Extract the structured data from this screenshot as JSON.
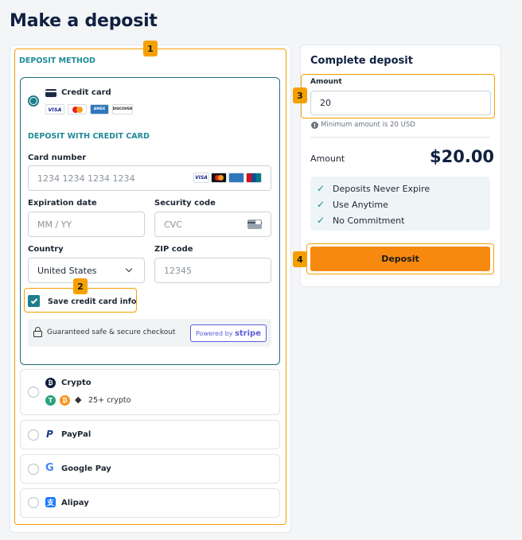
{
  "page_title": "Make a deposit",
  "callouts": [
    "1",
    "2",
    "3",
    "4"
  ],
  "deposit_method": {
    "heading": "DEPOSIT METHOD",
    "credit_card": {
      "name": "Credit card",
      "logos": [
        "VISA",
        "",
        "AMEX",
        "DISCOVER"
      ],
      "section_heading": "DEPOSIT WITH CREDIT CARD",
      "card_number": {
        "label": "Card number",
        "placeholder": "1234 1234 1234 1234"
      },
      "expiration": {
        "label": "Expiration date",
        "placeholder": "MM / YY"
      },
      "security": {
        "label": "Security code",
        "placeholder": "CVC"
      },
      "country": {
        "label": "Country",
        "value": "United States"
      },
      "zip": {
        "label": "ZIP code",
        "placeholder": "12345"
      },
      "save_card": {
        "label": "Save credit card info",
        "checked": true
      },
      "secure_text": "Guaranteed safe & secure checkout",
      "powered_by": "Powered by",
      "stripe": "stripe"
    },
    "crypto": {
      "name": "Crypto",
      "more": "25+ crypto"
    },
    "paypal": {
      "name": "PayPal"
    },
    "google_pay": {
      "name": "Google Pay"
    },
    "alipay": {
      "name": "Alipay"
    }
  },
  "complete": {
    "heading": "Complete deposit",
    "amount_label": "Amount",
    "amount_value": "20",
    "min_note": "Minimum amount is 20 USD",
    "summary_label": "Amount",
    "summary_value": "$20.00",
    "benefits": [
      "Deposits Never Expire",
      "Use Anytime",
      "No Commitment"
    ],
    "deposit_button": "Deposit"
  },
  "colors": {
    "accent": "#f5a000",
    "teal": "#1f8a99",
    "button": "#f7890f"
  }
}
